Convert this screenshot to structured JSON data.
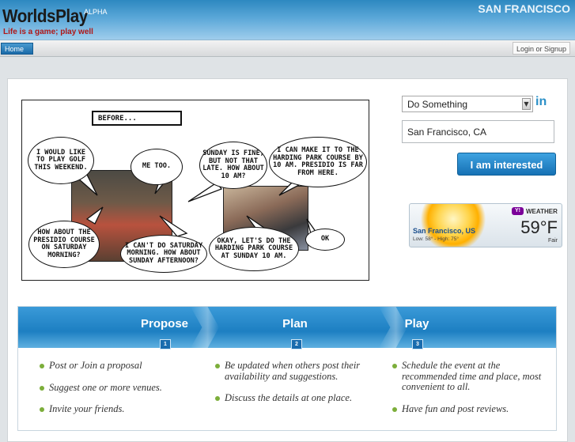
{
  "header": {
    "logo": "WorldsPlay",
    "badge": "ALPHA",
    "tagline": "Life is a game; play well",
    "city": "SAN FRANCISCO"
  },
  "nav": {
    "home": "Home",
    "login": "Login or Signup"
  },
  "comic": {
    "caption": "BEFORE...",
    "bubbles": [
      "I WOULD LIKE TO PLAY GOLF THIS WEEKEND.",
      "ME TOO.",
      "SUNDAY IS FINE, BUT NOT THAT LATE. HOW ABOUT 10 AM?",
      "I CAN MAKE IT TO THE HARDING PARK COURSE BY 10 AM. PRESIDIO IS FAR FROM HERE.",
      "HOW ABOUT THE PRESIDIO COURSE ON SATURDAY MORNING?",
      "I CAN'T DO SATURDAY MORNING. HOW ABOUT SUNDAY AFTERNOON?",
      "OKAY, LET'S DO THE HARDING PARK COURSE AT SUNDAY 10 AM.",
      "OK"
    ]
  },
  "form": {
    "activity": "Do Something",
    "in_label": "in",
    "location": "San Francisco, CA",
    "button": "I am interested"
  },
  "weather": {
    "city": "San Francisco, US",
    "lowhigh": "Low: 58° - High: 75°",
    "brand": "Y!",
    "label": "WEATHER",
    "temp": "59°F",
    "condition": "Fair"
  },
  "steps": [
    {
      "title": "Propose",
      "num": "1",
      "items": [
        "Post or Join a proposal",
        "Suggest one or more venues.",
        "Invite your friends."
      ]
    },
    {
      "title": "Plan",
      "num": "2",
      "items": [
        "Be updated when others post their availability and suggestions.",
        "Discuss the details at one place."
      ]
    },
    {
      "title": "Play",
      "num": "3",
      "items": [
        "Schedule the event at the recommended time and place, most convenient to all.",
        "Have fun and post reviews."
      ]
    }
  ]
}
